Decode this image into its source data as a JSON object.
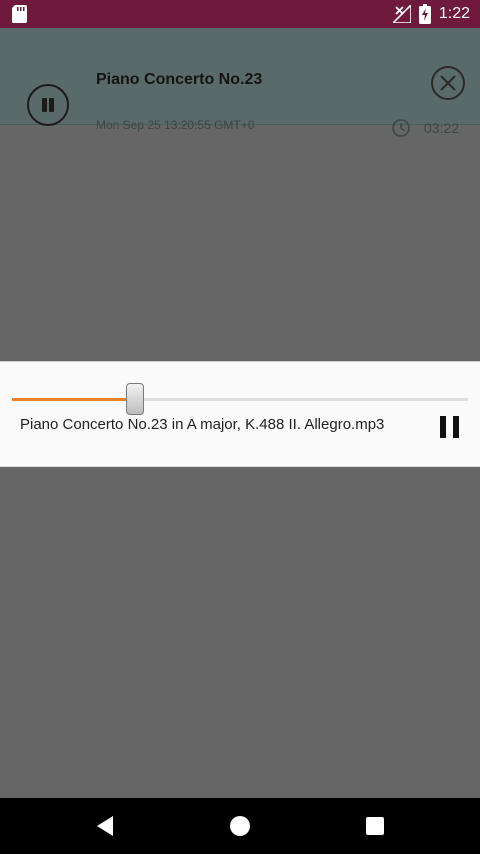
{
  "status_bar": {
    "time": "1:22",
    "icons": [
      "sd-card-icon",
      "no-signal-icon",
      "battery-charging-icon"
    ]
  },
  "notification": {
    "title": "Piano Concerto No.23",
    "date": "Mon Sep 25 13:20:55 GMT+0",
    "duration": "03:22",
    "icons": [
      "pause-icon",
      "close-icon",
      "clock-icon"
    ]
  },
  "player": {
    "track_title": "Piano Concerto No.23 in A major, K.488 II. Allegro.mp3",
    "progress": 0.27,
    "accent_color": "#e8822f"
  },
  "nav_bar": {
    "buttons": [
      "back",
      "home",
      "recents"
    ]
  }
}
